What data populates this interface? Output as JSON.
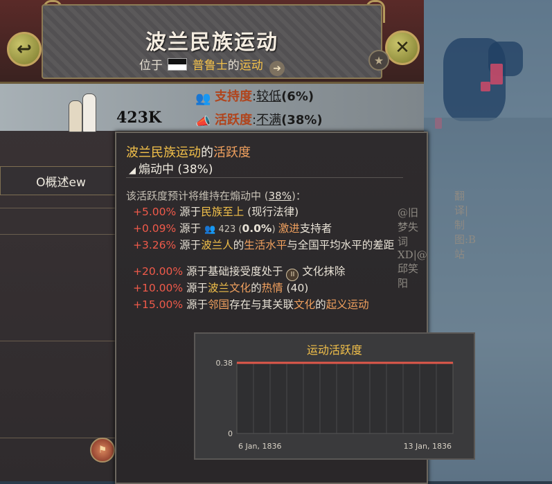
{
  "header": {
    "title": "波兰民族运动",
    "subtitle_prefix": "位于",
    "country": "普鲁士",
    "subtitle_mid": "的",
    "subtitle_link": "运动",
    "back_glyph": "↩",
    "close_glyph": "✕",
    "star_glyph": "★",
    "arrow_glyph": "➔"
  },
  "stats": {
    "population": "423K",
    "support_label": "支持度",
    "colon": ":",
    "support_level": "较低",
    "support_pct": "(6%)",
    "activism_label": "活跃度",
    "activism_level": "不满",
    "activism_pct": "(38%)"
  },
  "sidebar": {
    "tab_label": "O概述ew"
  },
  "tooltip": {
    "title_a": "波兰民族运动",
    "title_b": "的",
    "title_c": "活跃度",
    "state_icon": "◢",
    "state": "煽动中 (38%)",
    "predict_a": "该活跃度预计将维持在煽动中 (",
    "predict_pct": "38%",
    "predict_b": ")：",
    "lines": [
      {
        "pct": "+5.00%",
        "a": "源于",
        "b": "民族至上",
        "c": " (现行法律)"
      },
      {
        "pct": "+0.09%",
        "a": "源于",
        "icon": "👥",
        "num": " 423 (",
        "bold": "0.0%",
        "num2": ") ",
        "b": "激进",
        "c": "支持者"
      },
      {
        "pct": "+3.26%",
        "a": "源于",
        "b": "波兰人",
        "c": "的",
        "d": "生活水平",
        "e": "与全国平均水平的差距"
      },
      {
        "pct": "+20.00%",
        "a": "源于基础接受度处于 ",
        "roman": "II",
        "c": " 文化抹除"
      },
      {
        "pct": "+10.00%",
        "a": "源于",
        "b": "波兰",
        "c": "文化",
        "d": "的",
        "e": "热情",
        "f": " (40)"
      },
      {
        "pct": "+15.00%",
        "a": "源于",
        "b": "邻国",
        "c": "存在与其关联",
        "d": "文化",
        "e": "的",
        "f": "起义运动"
      }
    ]
  },
  "watermark": {
    "line1": "翻译|制图:B站",
    "line2": "@旧梦失词XD|@邱笑阳"
  },
  "chart_data": {
    "type": "line",
    "title": "运动活跃度",
    "x": [
      "6 Jan, 1836",
      "13 Jan, 1836"
    ],
    "series": [
      {
        "values": [
          0.38,
          0.38
        ],
        "color": "#e0584a"
      }
    ],
    "ylim": [
      0,
      0.38
    ],
    "yticks": [
      "0.38",
      "0"
    ],
    "xlabel": "",
    "ylabel": "",
    "grid": true
  }
}
